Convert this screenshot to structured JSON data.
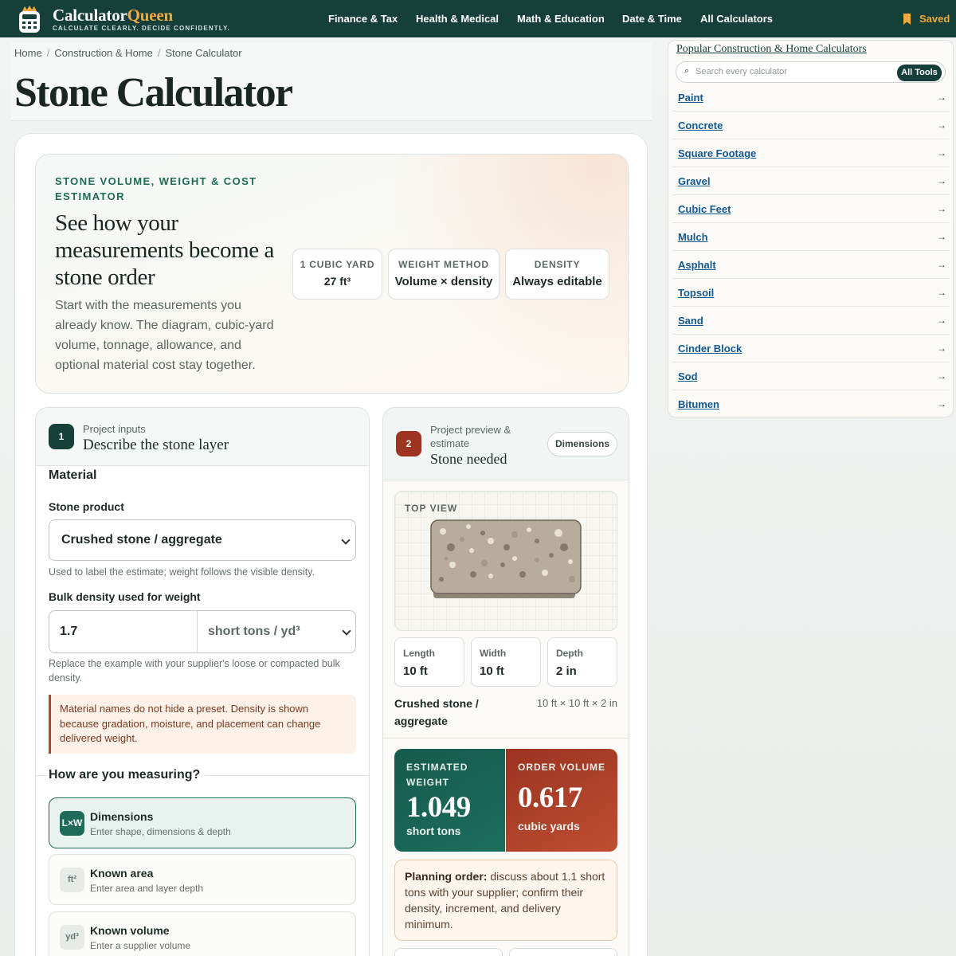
{
  "brand": {
    "name_main": "Calculator",
    "name_accent": "Queen",
    "tagline": "CALCULATE CLEARLY. DECIDE CONFIDENTLY."
  },
  "nav": {
    "items": [
      "Finance & Tax",
      "Health & Medical",
      "Math & Education",
      "Date & Time",
      "All Calculators"
    ],
    "saved": "Saved"
  },
  "breadcrumb": [
    "Home",
    "Construction & Home",
    "Stone Calculator"
  ],
  "page_title": "Stone Calculator",
  "hero": {
    "eyebrow": "STONE VOLUME, WEIGHT & COST ESTIMATOR",
    "title": "See how your measurements become a stone order",
    "description": "Start with the measurements you already know. The diagram, cubic-yard volume, tonnage, allowance, and optional material cost stay together.",
    "stats": [
      {
        "label": "1 CUBIC YARD",
        "value": "27 ft³"
      },
      {
        "label": "WEIGHT METHOD",
        "value": "Volume × density"
      },
      {
        "label": "DENSITY",
        "value": "Always editable"
      }
    ]
  },
  "inputs_panel": {
    "step": "1",
    "kicker": "Project inputs",
    "title": "Describe the stone layer",
    "material_heading": "Material",
    "stone_product_label": "Stone product",
    "stone_product_value": "Crushed stone / aggregate",
    "stone_product_help": "Used to label the estimate; weight follows the visible density.",
    "density_label": "Bulk density used for weight",
    "density_value": "1.7",
    "density_unit": "short tons / yd³",
    "density_help": "Replace the example with your supplier's loose or compacted bulk density.",
    "notice": "Material names do not hide a preset. Density is shown because gradation, moisture, and placement can change delivered weight.",
    "measuring_heading": "How are you measuring?",
    "modes": [
      {
        "icon": "L×W",
        "title": "Dimensions",
        "subtitle": "Enter shape, dimensions & depth",
        "selected": true
      },
      {
        "icon": "ft²",
        "title": "Known area",
        "subtitle": "Enter area and layer depth",
        "selected": false
      },
      {
        "icon": "yd³",
        "title": "Known volume",
        "subtitle": "Enter a supplier volume",
        "selected": false
      }
    ]
  },
  "preview_panel": {
    "step": "2",
    "kicker": "Project preview & estimate",
    "title": "Stone needed",
    "mode_pill": "Dimensions",
    "view_label": "TOP VIEW",
    "dims": [
      {
        "label": "Length",
        "value": "10 ft"
      },
      {
        "label": "Width",
        "value": "10 ft"
      },
      {
        "label": "Depth",
        "value": "2 in"
      }
    ],
    "product_name": "Crushed stone / aggregate",
    "product_dims": "10 ft × 10 ft × 2 in",
    "weight_label": "ESTIMATED WEIGHT",
    "weight_value": "1.049",
    "weight_unit": "short tons",
    "volume_label": "ORDER VOLUME",
    "volume_value": "0.617",
    "volume_unit": "cubic yards",
    "plan_bold": "Planning order:",
    "plan_text": " discuss about 1.1 short tons with your supplier; confirm their density, increment, and delivery minimum."
  },
  "sidebar": {
    "title": "Popular Construction & Home Calculators",
    "search_placeholder": "Search every calculator",
    "all_tools": "All Tools",
    "items": [
      "Paint",
      "Concrete",
      "Square Footage",
      "Gravel",
      "Cubic Feet",
      "Mulch",
      "Asphalt",
      "Topsoil",
      "Sand",
      "Cinder Block",
      "Sod",
      "Bitumen"
    ],
    "arrow": "→"
  },
  "colors": {
    "brand_dark": "#173f39",
    "accent_gold": "#f2a93b",
    "weight_green": "#1b6e5d",
    "volume_red": "#b0452e"
  }
}
